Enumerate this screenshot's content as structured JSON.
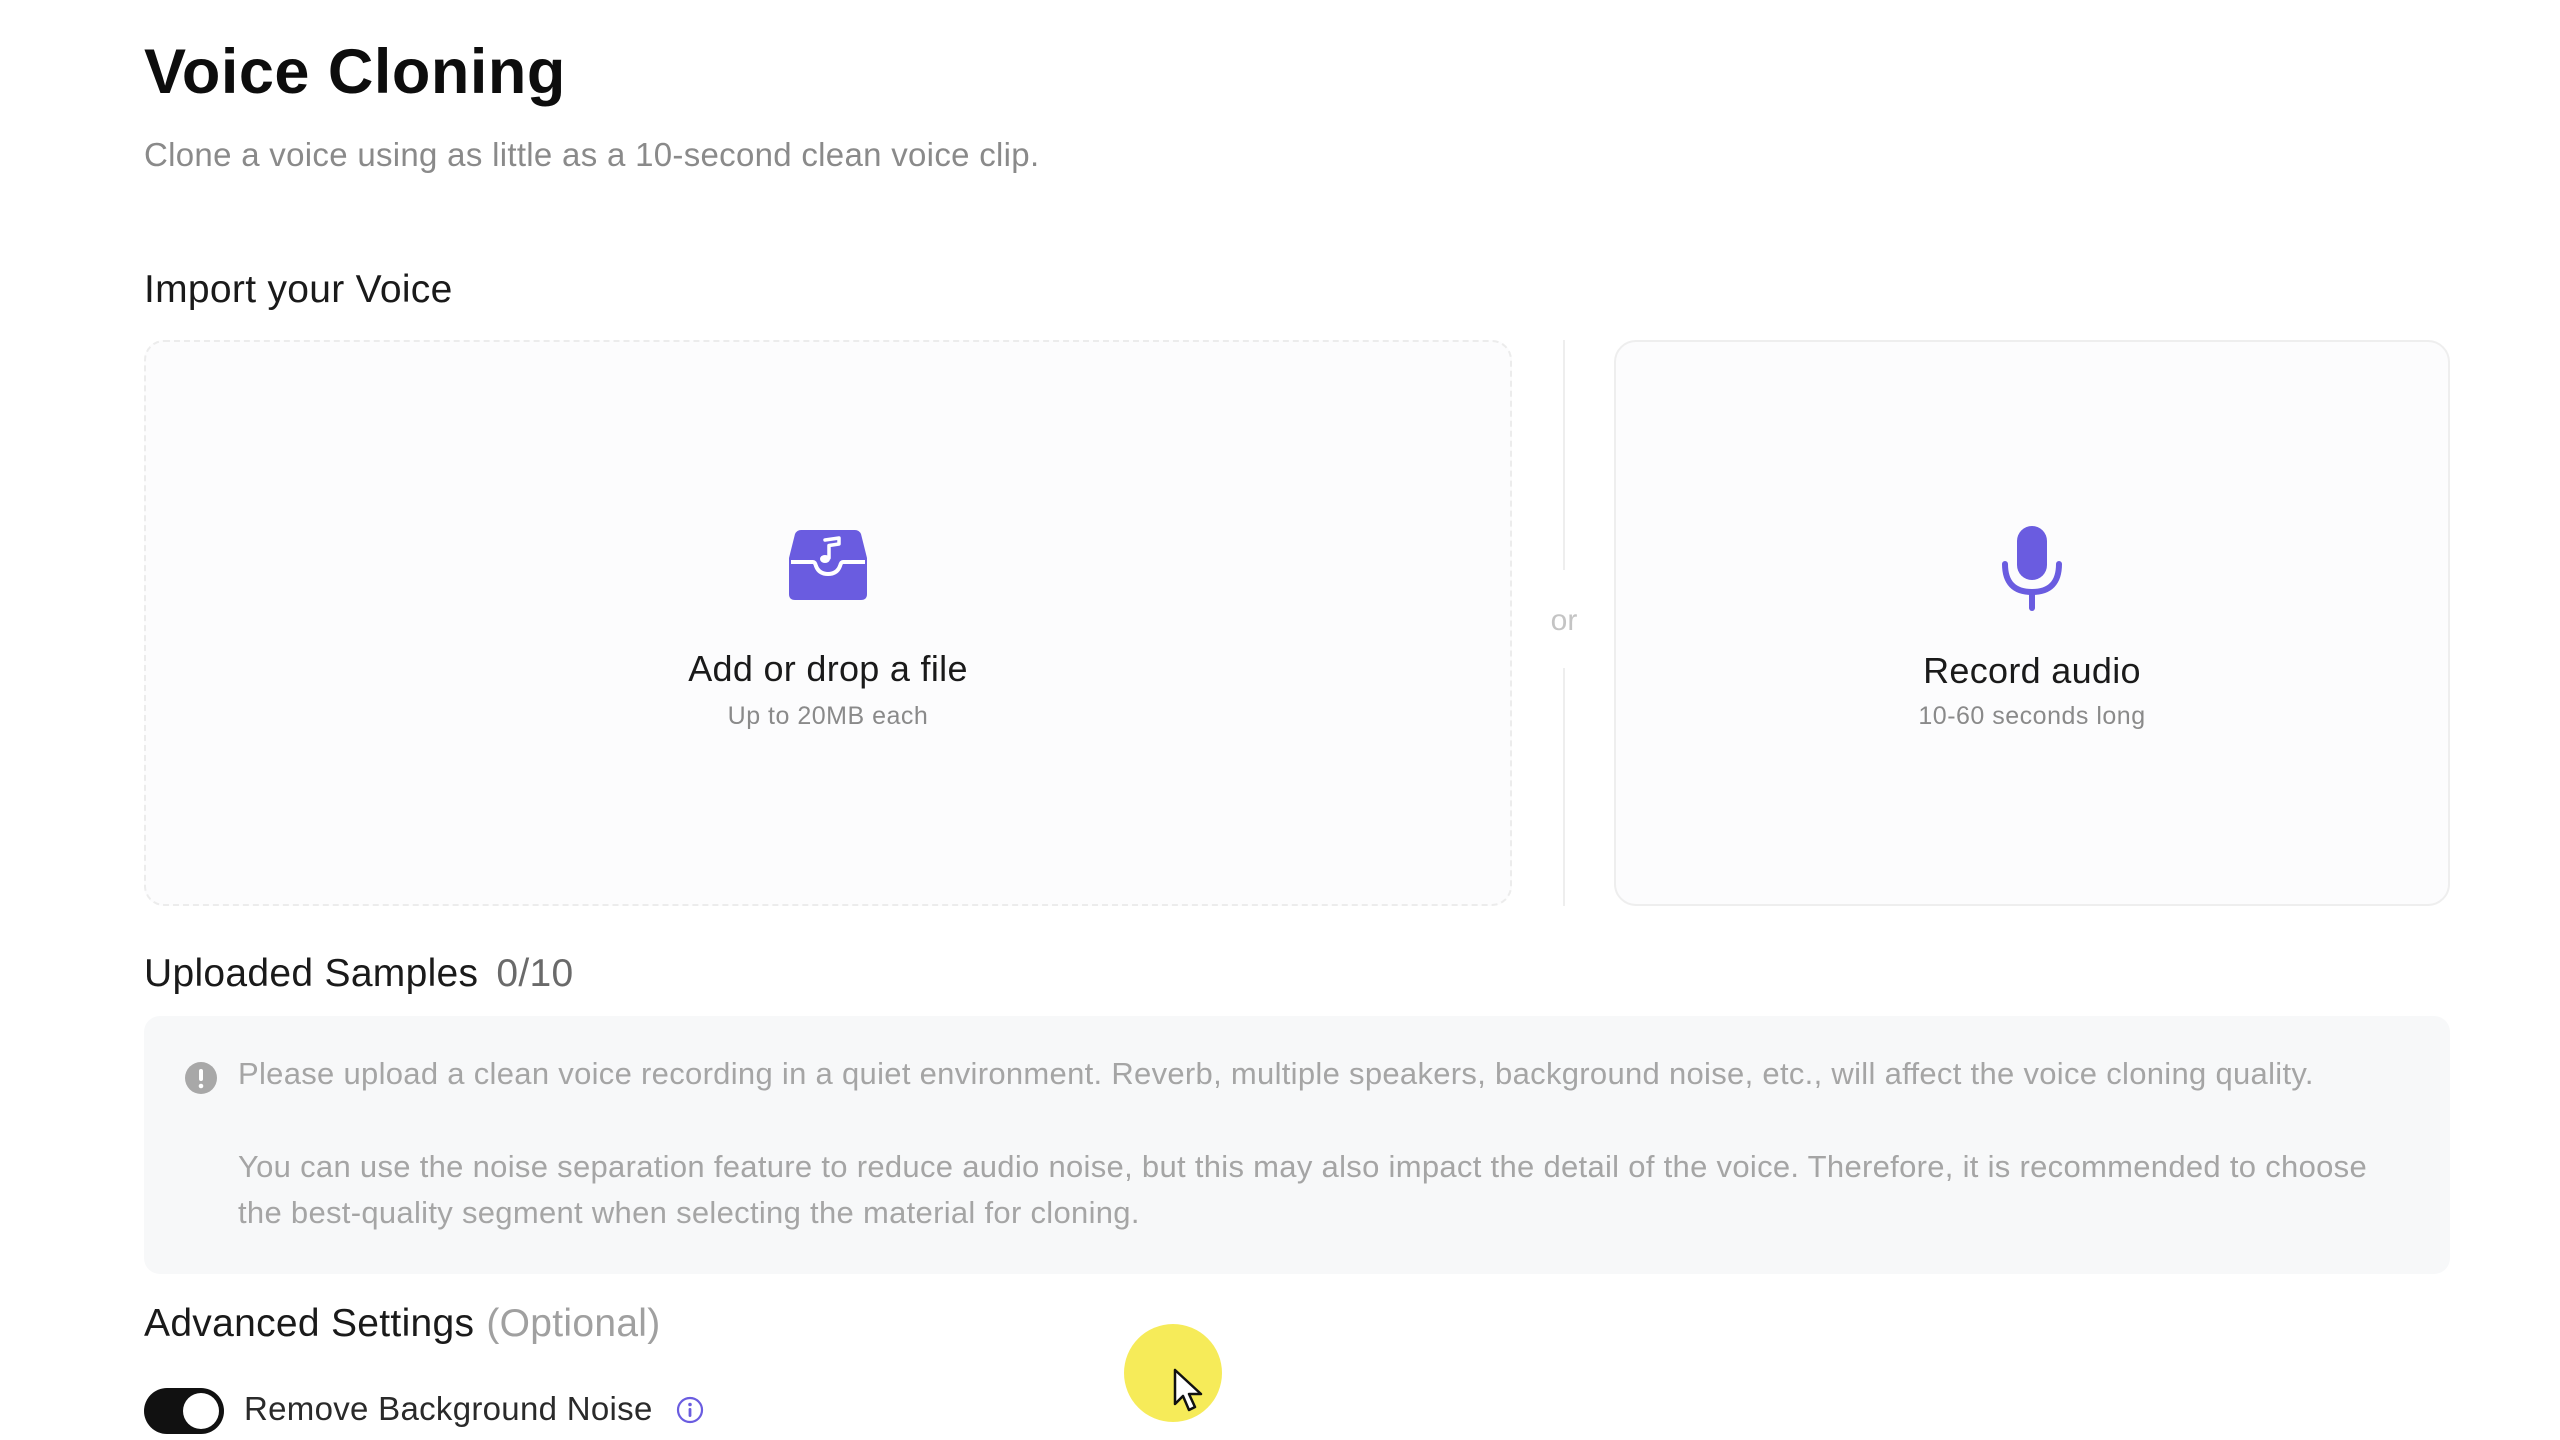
{
  "header": {
    "title": "Voice Cloning",
    "subtitle": "Clone a voice using as little as a 10-second clean voice clip."
  },
  "import": {
    "heading": "Import your Voice",
    "upload": {
      "label": "Add or drop a file",
      "hint": "Up to 20MB each",
      "icon": "music-inbox-icon"
    },
    "divider_text": "or",
    "record": {
      "label": "Record audio",
      "hint": "10-60 seconds long",
      "icon": "microphone-icon"
    }
  },
  "samples": {
    "heading": "Uploaded Samples",
    "count": "0/10",
    "notice_icon": "info-circle-icon",
    "notice_line1": "Please upload a clean voice recording in a quiet environment. Reverb, multiple speakers, background noise, etc., will affect the voice cloning quality.",
    "notice_line2": "You can use the noise separation feature to reduce audio noise, but this may also impact the detail of the voice. Therefore, it is recommended to choose the best-quality segment when selecting the material for cloning."
  },
  "advanced": {
    "heading": "Advanced Settings",
    "optional": "(Optional)",
    "remove_noise": {
      "label": "Remove Background Noise",
      "enabled": true
    }
  },
  "colors": {
    "accent": "#6a5ce0",
    "toggle_on": "#111111",
    "notice_bg": "#f7f8f9",
    "cursor_highlight": "#f5e83c"
  }
}
